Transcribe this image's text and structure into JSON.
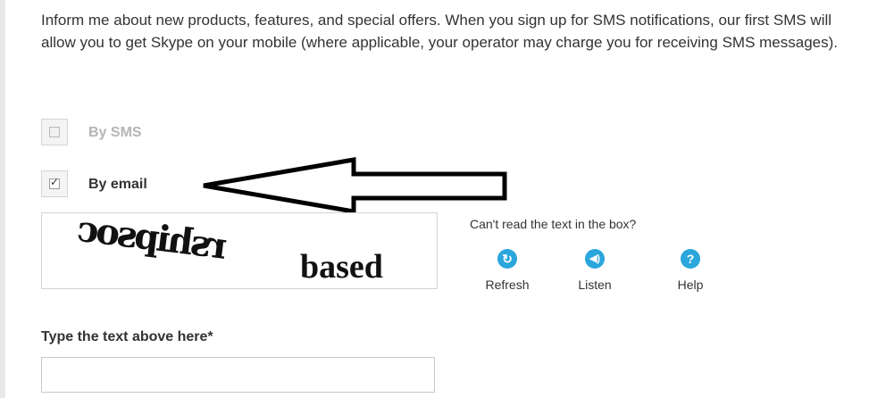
{
  "intro_text": "Inform me about new products, features, and special offers. When you sign up for SMS notifications, our first SMS will allow you to get Skype on your mobile (where applicable, your operator may charge you for receiving SMS messages).",
  "options": {
    "sms": {
      "label": "By SMS",
      "checked": false,
      "disabled": true
    },
    "email": {
      "label": "By email",
      "checked": true,
      "disabled": false
    }
  },
  "captcha": {
    "word1": "rshipsoc",
    "word2": "based",
    "help_question": "Can't read the text in the box?",
    "actions": [
      {
        "label": "Refresh",
        "icon": "refresh-icon"
      },
      {
        "label": "Listen",
        "icon": "speaker-icon"
      },
      {
        "label": "Help",
        "icon": "help-icon"
      }
    ]
  },
  "answer_field": {
    "label": "Type the text above here*",
    "value": "",
    "placeholder": ""
  },
  "colors": {
    "text": "#333333",
    "disabled_text": "#b5b5b5",
    "icon_blue": "#2aa6dc"
  }
}
